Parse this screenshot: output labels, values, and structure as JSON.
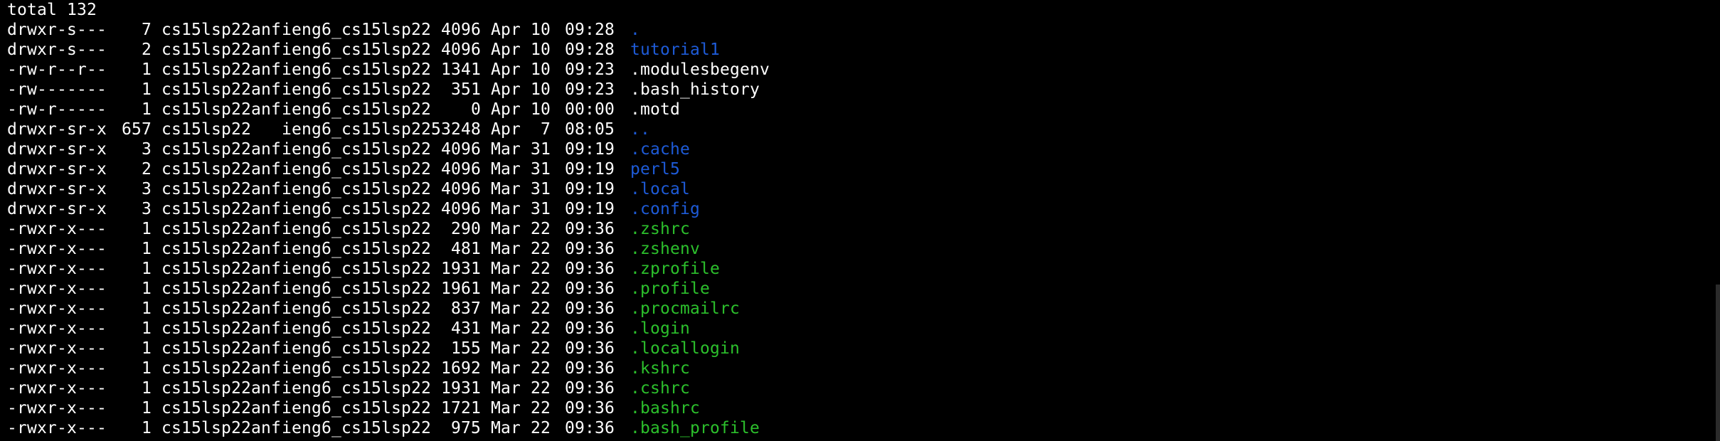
{
  "terminal": {
    "total_line": "total 132",
    "entries": [
      {
        "perms": "drwxr-s---",
        "links": "7",
        "owner": "cs15lsp22anf",
        "group": "ieng6_cs15lsp22",
        "size": "4096",
        "date": "Apr 10",
        "time": "09:28",
        "name": ".",
        "color": "blue"
      },
      {
        "perms": "drwxr-s---",
        "links": "2",
        "owner": "cs15lsp22anf",
        "group": "ieng6_cs15lsp22",
        "size": "4096",
        "date": "Apr 10",
        "time": "09:28",
        "name": "tutorial1",
        "color": "blue"
      },
      {
        "perms": "-rw-r--r--",
        "links": "1",
        "owner": "cs15lsp22anf",
        "group": "ieng6_cs15lsp22",
        "size": "1341",
        "date": "Apr 10",
        "time": "09:23",
        "name": ".modulesbegenv",
        "color": "white"
      },
      {
        "perms": "-rw-------",
        "links": "1",
        "owner": "cs15lsp22anf",
        "group": "ieng6_cs15lsp22",
        "size": "351",
        "date": "Apr 10",
        "time": "09:23",
        "name": ".bash_history",
        "color": "white"
      },
      {
        "perms": "-rw-r-----",
        "links": "1",
        "owner": "cs15lsp22anf",
        "group": "ieng6_cs15lsp22",
        "size": "0",
        "date": "Apr 10",
        "time": "00:00",
        "name": ".motd",
        "color": "white"
      },
      {
        "perms": "drwxr-sr-x",
        "links": "657",
        "owner": "cs15lsp22",
        "group": "ieng6_cs15lsp22",
        "size": "53248",
        "date": "Apr  7",
        "time": "08:05",
        "name": "..",
        "color": "blue"
      },
      {
        "perms": "drwxr-sr-x",
        "links": "3",
        "owner": "cs15lsp22anf",
        "group": "ieng6_cs15lsp22",
        "size": "4096",
        "date": "Mar 31",
        "time": "09:19",
        "name": ".cache",
        "color": "blue"
      },
      {
        "perms": "drwxr-sr-x",
        "links": "2",
        "owner": "cs15lsp22anf",
        "group": "ieng6_cs15lsp22",
        "size": "4096",
        "date": "Mar 31",
        "time": "09:19",
        "name": "perl5",
        "color": "blue"
      },
      {
        "perms": "drwxr-sr-x",
        "links": "3",
        "owner": "cs15lsp22anf",
        "group": "ieng6_cs15lsp22",
        "size": "4096",
        "date": "Mar 31",
        "time": "09:19",
        "name": ".local",
        "color": "blue"
      },
      {
        "perms": "drwxr-sr-x",
        "links": "3",
        "owner": "cs15lsp22anf",
        "group": "ieng6_cs15lsp22",
        "size": "4096",
        "date": "Mar 31",
        "time": "09:19",
        "name": ".config",
        "color": "blue"
      },
      {
        "perms": "-rwxr-x---",
        "links": "1",
        "owner": "cs15lsp22anf",
        "group": "ieng6_cs15lsp22",
        "size": "290",
        "date": "Mar 22",
        "time": "09:36",
        "name": ".zshrc",
        "color": "green"
      },
      {
        "perms": "-rwxr-x---",
        "links": "1",
        "owner": "cs15lsp22anf",
        "group": "ieng6_cs15lsp22",
        "size": "481",
        "date": "Mar 22",
        "time": "09:36",
        "name": ".zshenv",
        "color": "green"
      },
      {
        "perms": "-rwxr-x---",
        "links": "1",
        "owner": "cs15lsp22anf",
        "group": "ieng6_cs15lsp22",
        "size": "1931",
        "date": "Mar 22",
        "time": "09:36",
        "name": ".zprofile",
        "color": "green"
      },
      {
        "perms": "-rwxr-x---",
        "links": "1",
        "owner": "cs15lsp22anf",
        "group": "ieng6_cs15lsp22",
        "size": "1961",
        "date": "Mar 22",
        "time": "09:36",
        "name": ".profile",
        "color": "green"
      },
      {
        "perms": "-rwxr-x---",
        "links": "1",
        "owner": "cs15lsp22anf",
        "group": "ieng6_cs15lsp22",
        "size": "837",
        "date": "Mar 22",
        "time": "09:36",
        "name": ".procmailrc",
        "color": "green"
      },
      {
        "perms": "-rwxr-x---",
        "links": "1",
        "owner": "cs15lsp22anf",
        "group": "ieng6_cs15lsp22",
        "size": "431",
        "date": "Mar 22",
        "time": "09:36",
        "name": ".login",
        "color": "green"
      },
      {
        "perms": "-rwxr-x---",
        "links": "1",
        "owner": "cs15lsp22anf",
        "group": "ieng6_cs15lsp22",
        "size": "155",
        "date": "Mar 22",
        "time": "09:36",
        "name": ".locallogin",
        "color": "green"
      },
      {
        "perms": "-rwxr-x---",
        "links": "1",
        "owner": "cs15lsp22anf",
        "group": "ieng6_cs15lsp22",
        "size": "1692",
        "date": "Mar 22",
        "time": "09:36",
        "name": ".kshrc",
        "color": "green"
      },
      {
        "perms": "-rwxr-x---",
        "links": "1",
        "owner": "cs15lsp22anf",
        "group": "ieng6_cs15lsp22",
        "size": "1931",
        "date": "Mar 22",
        "time": "09:36",
        "name": ".cshrc",
        "color": "green"
      },
      {
        "perms": "-rwxr-x---",
        "links": "1",
        "owner": "cs15lsp22anf",
        "group": "ieng6_cs15lsp22",
        "size": "1721",
        "date": "Mar 22",
        "time": "09:36",
        "name": ".bashrc",
        "color": "green"
      },
      {
        "perms": "-rwxr-x---",
        "links": "1",
        "owner": "cs15lsp22anf",
        "group": "ieng6_cs15lsp22",
        "size": "975",
        "date": "Mar 22",
        "time": "09:36",
        "name": ".bash_profile",
        "color": "green"
      }
    ]
  },
  "colors": {
    "background": "#000000",
    "text": "#ffffff",
    "directory": "#1e5bd8",
    "executable": "#2cc02c"
  }
}
